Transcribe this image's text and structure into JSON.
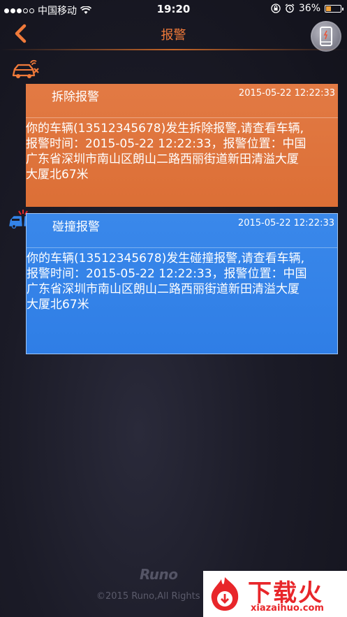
{
  "status_bar": {
    "carrier": "中国移动",
    "time": "19:20",
    "battery": "36%",
    "battery_level": 0.36
  },
  "nav": {
    "title": "报警"
  },
  "alerts": [
    {
      "title": "拆除报警",
      "time": "2015-05-22 12:22:33",
      "lines": [
        "你的车辆(13512345678)发生拆除报警,请查看车辆,",
        "报警时间：2015-05-22 12:22:33，报警位置：中国",
        "广东省深圳市南山区朗山二路西丽街道新田清溢大厦",
        "大厦北67米"
      ],
      "color": "#e07540"
    },
    {
      "title": "碰撞报警",
      "time": "2015-05-22 12:22:33",
      "lines": [
        "你的车辆(13512345678)发生碰撞报警,请查看车辆,",
        "报警时间：2015-05-22 12:22:33，报警位置：中国",
        "广东省深圳市南山区朗山二路西丽街道新田清溢大厦",
        "大厦北67米"
      ],
      "color": "#3384e8"
    }
  ],
  "footer": {
    "brand": "Runo",
    "copyright": "©2015 Runo,All Rights"
  },
  "watermark": {
    "name": "下载火",
    "domain": "xiazaihuo.com"
  },
  "colors": {
    "accent": "#f07a3a",
    "background": "#1b1b27"
  }
}
